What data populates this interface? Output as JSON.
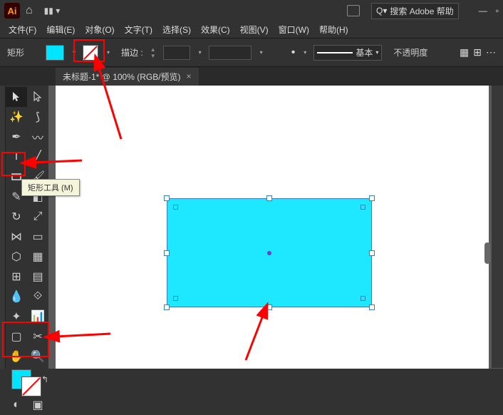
{
  "titlebar": {
    "logo": "Ai",
    "search_placeholder": "搜索 Adobe 帮助"
  },
  "menubar": {
    "file": "文件(F)",
    "edit": "编辑(E)",
    "object": "对象(O)",
    "type": "文字(T)",
    "select": "选择(S)",
    "effect": "效果(C)",
    "view": "视图(V)",
    "window": "窗口(W)",
    "help": "帮助(H)"
  },
  "controlbar": {
    "shape_label": "矩形",
    "stroke_label": "描边",
    "stroke_weight": "",
    "style_label": "基本",
    "opacity_label": "不透明度"
  },
  "tabs": {
    "doc1": {
      "label": "未标题-1* @ 100% (RGB/预览)"
    }
  },
  "tooltip": {
    "rect_tool": "矩形工具 (M)"
  },
  "colors": {
    "fill": "#00e5ff",
    "rect_fill": "#1ee8ff"
  },
  "chart_data": null
}
